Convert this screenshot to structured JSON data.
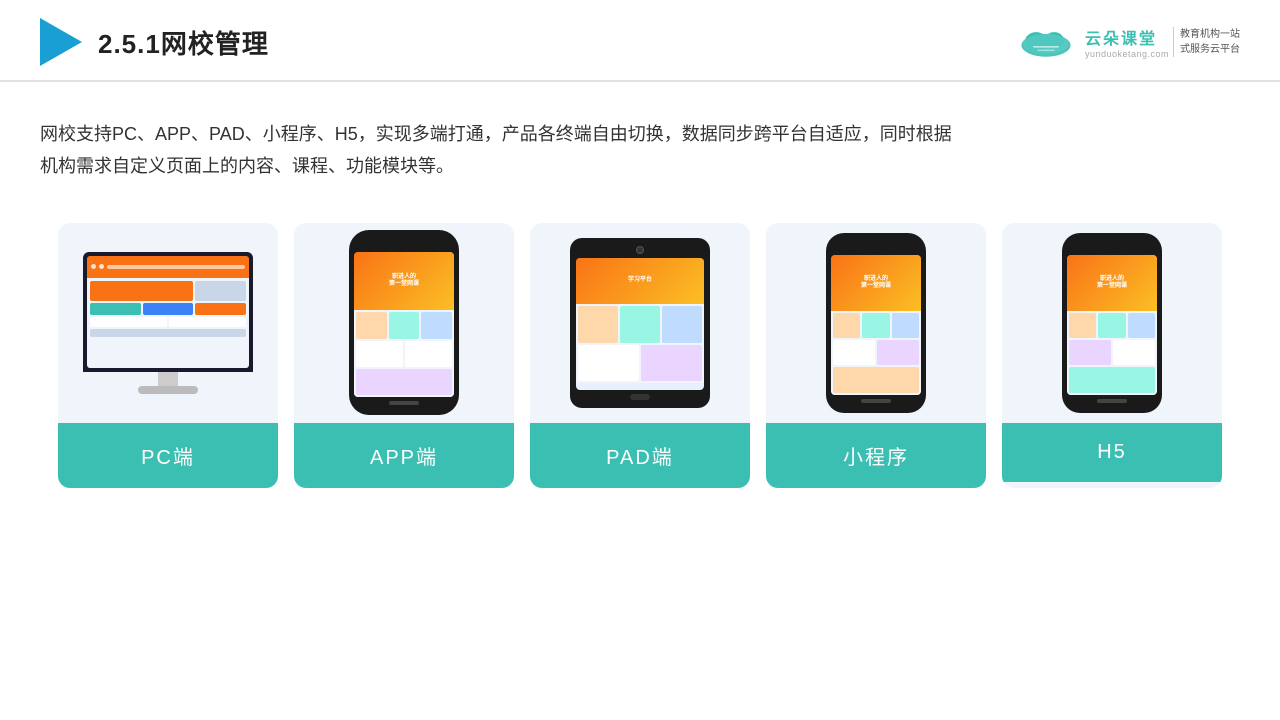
{
  "header": {
    "title": "2.5.1网校管理",
    "brand_name": "云朵课堂",
    "brand_url": "yunduoketang.com",
    "brand_slogan_line1": "教育机构一站",
    "brand_slogan_line2": "式服务云平台"
  },
  "description": {
    "text": "网校支持PC、APP、PAD、小程序、H5，实现多端打通，产品各终端自由切换，数据同步跨平台自适应，同时根据机构需求自定义页面上的内容、课程、功能模块等。"
  },
  "cards": [
    {
      "id": "pc",
      "label": "PC端"
    },
    {
      "id": "app",
      "label": "APP端"
    },
    {
      "id": "pad",
      "label": "PAD端"
    },
    {
      "id": "miniprogram",
      "label": "小程序"
    },
    {
      "id": "h5",
      "label": "H5"
    }
  ]
}
